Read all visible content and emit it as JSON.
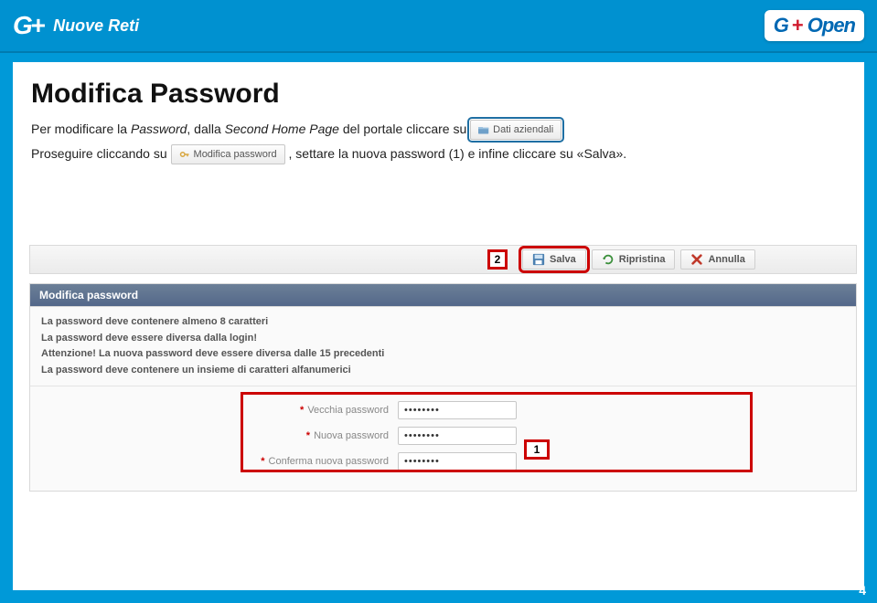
{
  "topbar": {
    "brand_g": "G",
    "brand_plus": "+",
    "brand_sub": "Nuove Reti",
    "right_g": "G",
    "right_plus": "+",
    "right_open": "Open"
  },
  "slide": {
    "title": "Modifica Password",
    "instr_line1_a": "Per modificare la ",
    "instr_line1_b": "Password",
    "instr_line1_c": ", dalla ",
    "instr_line1_d": "Second Home Page",
    "instr_line1_e": " del portale cliccare su ",
    "btn_dati_aziendali": "Dati aziendali",
    "instr_line2_a": "Proseguire cliccando su ",
    "btn_modifica_password": "Modifica password",
    "instr_line2_b": ", settare la nuova password (1) e infine cliccare su «Salva».",
    "page_number": "4"
  },
  "callouts": {
    "c1": "1",
    "c2": "2"
  },
  "toolbar": {
    "salva": "Salva",
    "ripristina": "Ripristina",
    "annulla": "Annulla"
  },
  "panel": {
    "header": "Modifica password",
    "rules": [
      "La password deve contenere almeno 8 caratteri",
      "La password deve essere diversa dalla login!",
      "Attenzione! La nuova password deve essere diversa dalle 15 precedenti",
      "La password deve contenere un insieme di caratteri alfanumerici"
    ],
    "fields": {
      "old_label": "Vecchia password",
      "new_label": "Nuova password",
      "confirm_label": "Conferma nuova password",
      "old_value": "••••••••",
      "new_value": "••••••••",
      "confirm_value": "••••••••"
    }
  }
}
